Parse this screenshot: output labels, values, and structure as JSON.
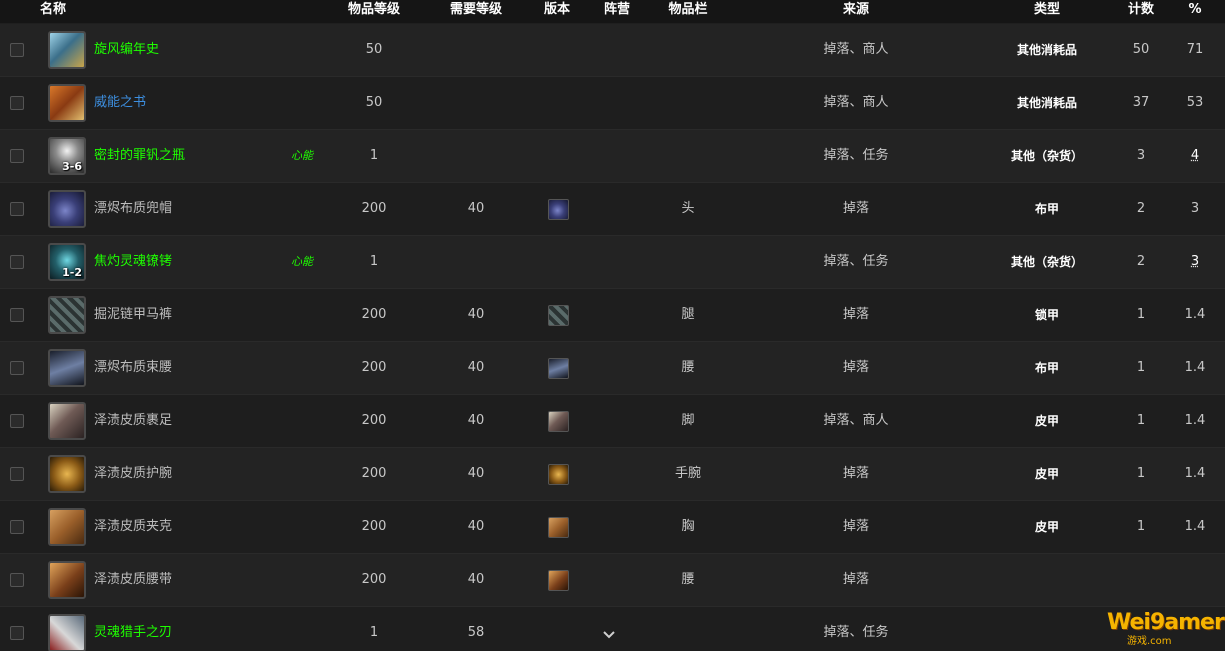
{
  "columns": {
    "name": "名称",
    "item_level": "物品等级",
    "req_level": "需要等级",
    "version": "版本",
    "faction": "阵营",
    "slot": "物品栏",
    "source": "来源",
    "type": "类型",
    "count": "计数",
    "percent": "%"
  },
  "rows": [
    {
      "name": "旋风编年史",
      "quality": "green",
      "tag": "",
      "qty": "",
      "item_level": "50",
      "req_level": "",
      "has_version": false,
      "slot": "",
      "source": "掉落、商人",
      "type": "其他消耗品",
      "count": "50",
      "percent": "71",
      "pct_u": false,
      "icon": "chronicle-icon"
    },
    {
      "name": "威能之书",
      "quality": "blue",
      "tag": "",
      "qty": "",
      "item_level": "50",
      "req_level": "",
      "has_version": false,
      "slot": "",
      "source": "掉落、商人",
      "type": "其他消耗品",
      "count": "37",
      "percent": "53",
      "pct_u": false,
      "icon": "book-icon"
    },
    {
      "name": "密封的罪钒之瓶",
      "quality": "green",
      "tag": "心能",
      "qty": "3-6",
      "item_level": "1",
      "req_level": "",
      "has_version": false,
      "slot": "",
      "source": "掉落、任务",
      "type": "其他（杂货）",
      "count": "3",
      "percent": "4",
      "pct_u": true,
      "icon": "vial-icon"
    },
    {
      "name": "漂烬布质兜帽",
      "quality": "gray",
      "tag": "",
      "qty": "",
      "item_level": "200",
      "req_level": "40",
      "has_version": true,
      "slot": "头",
      "source": "掉落",
      "type": "布甲",
      "count": "2",
      "percent": "3",
      "pct_u": false,
      "icon": "hood-icon"
    },
    {
      "name": "焦灼灵魂镣铐",
      "quality": "green",
      "tag": "心能",
      "qty": "1-2",
      "item_level": "1",
      "req_level": "",
      "has_version": false,
      "slot": "",
      "source": "掉落、任务",
      "type": "其他（杂货）",
      "count": "2",
      "percent": "3",
      "pct_u": true,
      "icon": "shackle-icon"
    },
    {
      "name": "掘泥链甲马裤",
      "quality": "gray",
      "tag": "",
      "qty": "",
      "item_level": "200",
      "req_level": "40",
      "has_version": true,
      "slot": "腿",
      "source": "掉落",
      "type": "锁甲",
      "count": "1",
      "percent": "1.4",
      "pct_u": false,
      "icon": "mail-legs-icon"
    },
    {
      "name": "漂烬布质束腰",
      "quality": "gray",
      "tag": "",
      "qty": "",
      "item_level": "200",
      "req_level": "40",
      "has_version": true,
      "slot": "腰",
      "source": "掉落",
      "type": "布甲",
      "count": "1",
      "percent": "1.4",
      "pct_u": false,
      "icon": "cloth-belt-icon"
    },
    {
      "name": "泽渍皮质裹足",
      "quality": "gray",
      "tag": "",
      "qty": "",
      "item_level": "200",
      "req_level": "40",
      "has_version": true,
      "slot": "脚",
      "source": "掉落、商人",
      "type": "皮甲",
      "count": "1",
      "percent": "1.4",
      "pct_u": false,
      "icon": "boots-icon"
    },
    {
      "name": "泽渍皮质护腕",
      "quality": "gray",
      "tag": "",
      "qty": "",
      "item_level": "200",
      "req_level": "40",
      "has_version": true,
      "slot": "手腕",
      "source": "掉落",
      "type": "皮甲",
      "count": "1",
      "percent": "1.4",
      "pct_u": false,
      "icon": "bracer-icon"
    },
    {
      "name": "泽渍皮质夹克",
      "quality": "gray",
      "tag": "",
      "qty": "",
      "item_level": "200",
      "req_level": "40",
      "has_version": true,
      "slot": "胸",
      "source": "掉落",
      "type": "皮甲",
      "count": "1",
      "percent": "1.4",
      "pct_u": false,
      "icon": "jacket-icon"
    },
    {
      "name": "泽渍皮质腰带",
      "quality": "gray",
      "tag": "",
      "qty": "",
      "item_level": "200",
      "req_level": "40",
      "has_version": true,
      "slot": "腰",
      "source": "掉落",
      "type": "",
      "count": "",
      "percent": "",
      "pct_u": false,
      "icon": "leather-belt-icon"
    },
    {
      "name": "灵魂猎手之刃",
      "quality": "green",
      "tag": "",
      "qty": "",
      "item_level": "1",
      "req_level": "58",
      "has_version": false,
      "slot": "",
      "source": "掉落、任务",
      "type": "",
      "count": "",
      "percent": "",
      "pct_u": false,
      "icon": "blade-icon"
    }
  ],
  "watermark": {
    "text": "Wei9amer",
    "sub": "游戏.com"
  },
  "colors": {
    "green": "#1eff00",
    "blue": "#3d8fe0",
    "gray": "#bdbdbd",
    "background": "#1f1f1f",
    "header": "#151515"
  }
}
